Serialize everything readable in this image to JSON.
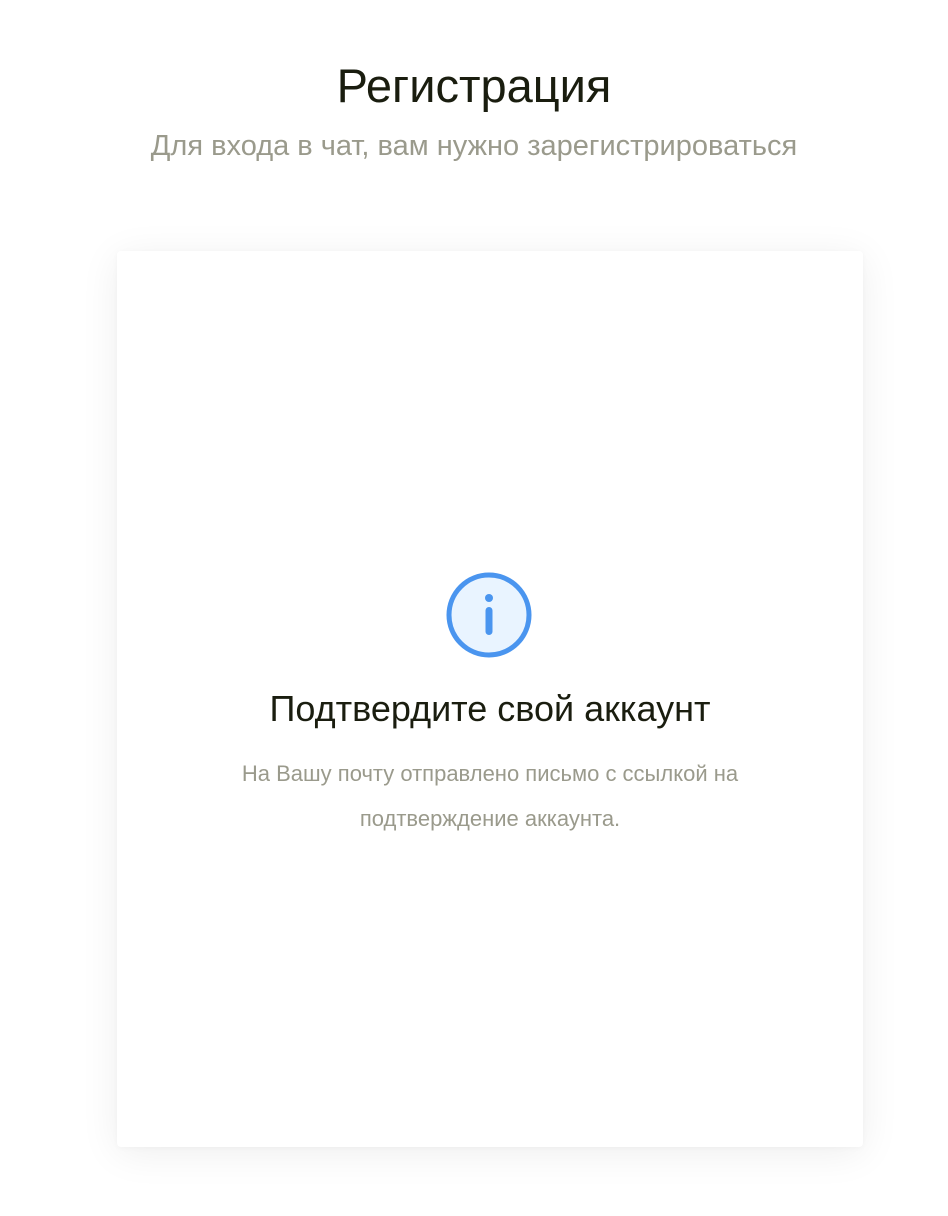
{
  "header": {
    "title": "Регистрация",
    "subtitle": "Для входа в чат, вам нужно зарегистрироваться"
  },
  "card": {
    "icon": "info-icon",
    "title": "Подтвердите свой аккаунт",
    "message": "На Вашу почту отправлено письмо с ссылкой на подтверждение аккаунта."
  },
  "colors": {
    "text_primary": "#1a1d0f",
    "text_secondary": "#9a9a8c",
    "icon_blue": "#4a95ef",
    "icon_fill": "#e9f4ff"
  }
}
